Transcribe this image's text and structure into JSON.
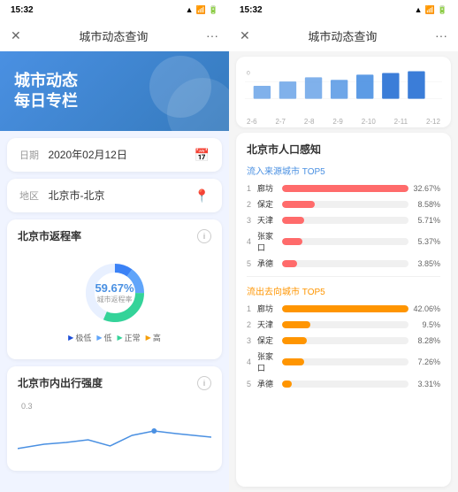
{
  "app": {
    "title": "城市动态查询",
    "time": "15:32"
  },
  "left": {
    "banner": {
      "line1": "城市动态",
      "line2": "每日专栏"
    },
    "date_label": "日期",
    "date_value": "2020年02月12日",
    "region_label": "地区",
    "region_value": "北京市-北京",
    "return_rate_title": "北京市返程率",
    "return_rate_pct": "59.67%",
    "return_rate_sub": "城市返程率",
    "legend": {
      "very_low": "极低",
      "low": "低",
      "normal": "正常",
      "high": "高"
    },
    "travel_title": "北京市内出行强度",
    "travel_value": "0.3"
  },
  "right": {
    "graph_labels": [
      "2-6",
      "2-7",
      "2-8",
      "2-9",
      "2-10",
      "2-11",
      "2-12"
    ],
    "pop_title": "北京市人口感知",
    "inflow_title": "流入来源城市 TOP5",
    "inflow": [
      {
        "rank": 1,
        "city": "廊坊",
        "pct": "32.67%",
        "ratio": 1.0
      },
      {
        "rank": 2,
        "city": "保定",
        "pct": "8.58%",
        "ratio": 0.26
      },
      {
        "rank": 3,
        "city": "天津",
        "pct": "5.71%",
        "ratio": 0.175
      },
      {
        "rank": 4,
        "city": "张家口",
        "pct": "5.37%",
        "ratio": 0.164
      },
      {
        "rank": 5,
        "city": "承德",
        "pct": "3.85%",
        "ratio": 0.118
      }
    ],
    "outflow_title": "流出去向城市 TOP5",
    "outflow": [
      {
        "rank": 1,
        "city": "廊坊",
        "pct": "42.06%",
        "ratio": 1.0
      },
      {
        "rank": 2,
        "city": "天津",
        "pct": "9.5%",
        "ratio": 0.226
      },
      {
        "rank": 3,
        "city": "保定",
        "pct": "8.28%",
        "ratio": 0.197
      },
      {
        "rank": 4,
        "city": "张家口",
        "pct": "7.26%",
        "ratio": 0.173
      },
      {
        "rank": 5,
        "city": "承德",
        "pct": "3.31%",
        "ratio": 0.079
      }
    ]
  }
}
